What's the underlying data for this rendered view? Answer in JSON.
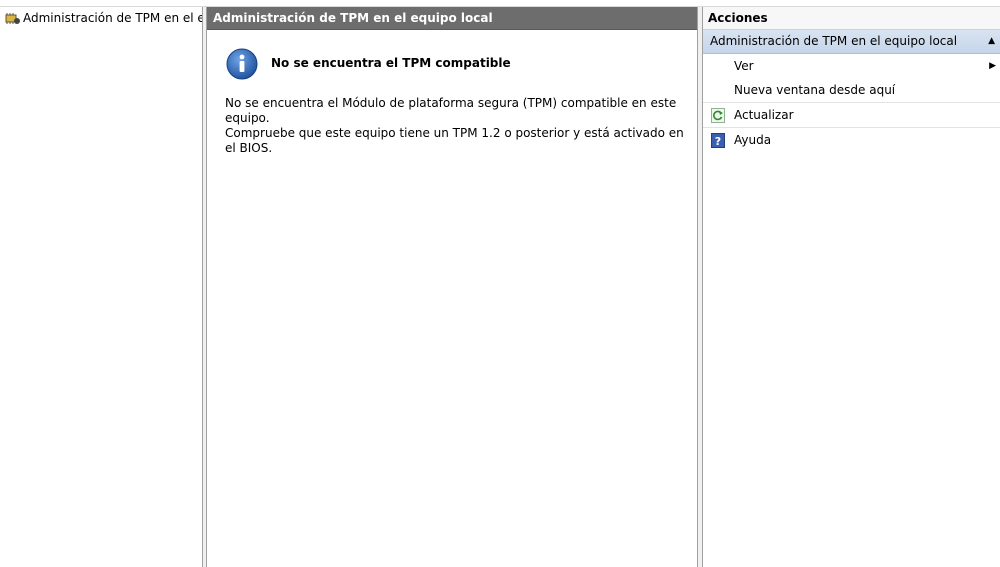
{
  "tree": {
    "root_label": "Administración de TPM en el equipo local",
    "root_icon": "tpm-chip-icon"
  },
  "center": {
    "header": "Administración de TPM en el equipo local",
    "message_title": "No se encuentra el TPM compatible",
    "message_line1": "No se encuentra el Módulo de plataforma segura (TPM) compatible en este equipo.",
    "message_line2": "Compruebe que este equipo tiene un TPM 1.2 o posterior y está activado en el BIOS.",
    "icon": "info-icon"
  },
  "actions": {
    "title": "Acciones",
    "section": "Administración de TPM en el equipo local",
    "items": [
      {
        "label": "Ver",
        "icon": "none",
        "has_submenu": true
      },
      {
        "label": "Nueva ventana desde aquí",
        "icon": "none"
      },
      {
        "label": "Actualizar",
        "icon": "refresh-icon"
      },
      {
        "label": "Ayuda",
        "icon": "help-icon"
      }
    ]
  },
  "colors": {
    "center_header_bg": "#6d6d6d",
    "actions_section_bg": "#c5d5ea",
    "info_icon_blue": "#2a64b8"
  }
}
